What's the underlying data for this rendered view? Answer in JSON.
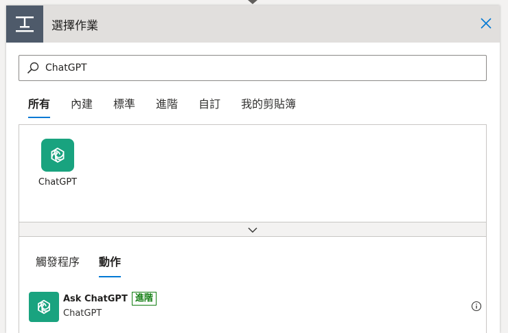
{
  "dialog": {
    "title": "選擇作業",
    "icon": "action-insert-icon",
    "close_icon": "close-icon"
  },
  "search": {
    "value": "ChatGPT",
    "placeholder": ""
  },
  "tabs": [
    {
      "label": "所有",
      "active": true
    },
    {
      "label": "內建",
      "active": false
    },
    {
      "label": "標準",
      "active": false
    },
    {
      "label": "進階",
      "active": false
    },
    {
      "label": "自訂",
      "active": false
    },
    {
      "label": "我的剪貼簿",
      "active": false
    }
  ],
  "connectors": [
    {
      "label": "ChatGPT",
      "icon": "openai-icon"
    }
  ],
  "subtabs": [
    {
      "label": "觸發程序",
      "active": false
    },
    {
      "label": "動作",
      "active": true
    }
  ],
  "actions": [
    {
      "title": "Ask ChatGPT",
      "badge": "進階",
      "connector": "ChatGPT"
    }
  ],
  "colors": {
    "accent": "#0078d4",
    "header_bg": "#e1dfdd",
    "header_icon_bg": "#4e5a6a",
    "app_icon_bg": "#19a37f",
    "premium": "#107c10"
  }
}
